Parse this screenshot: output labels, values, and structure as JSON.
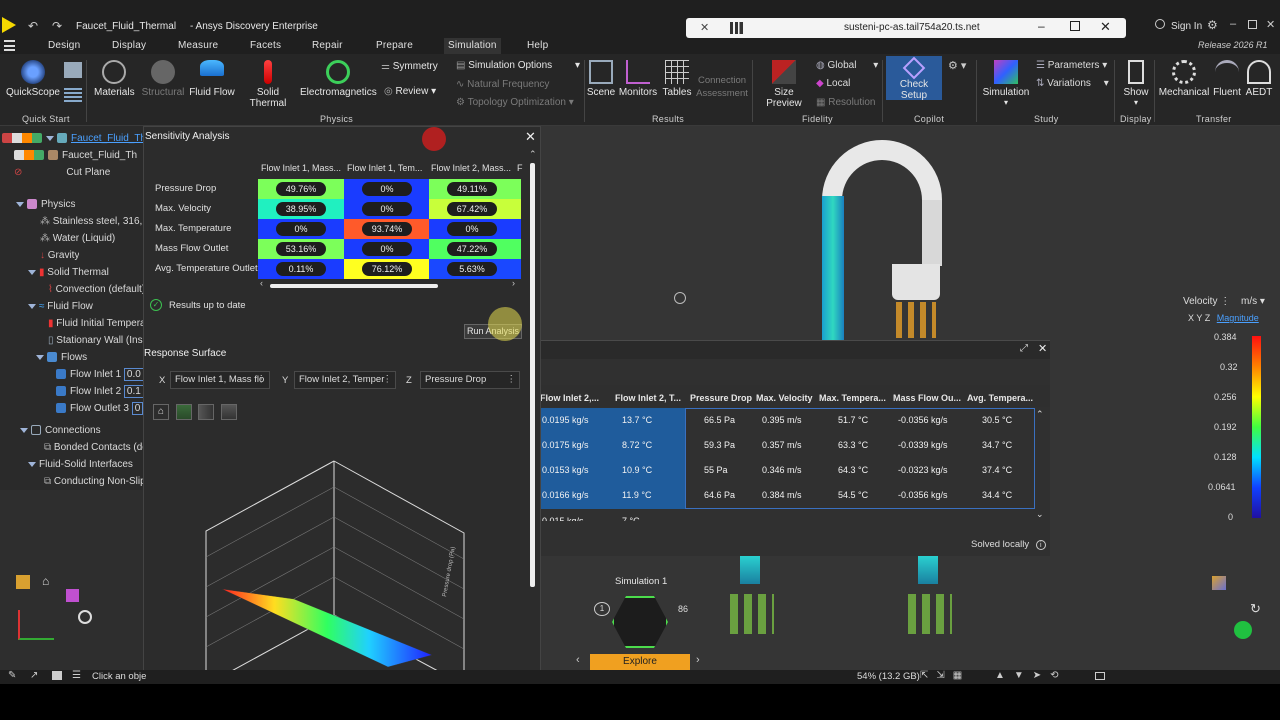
{
  "app": {
    "title": "Faucet_Fluid_Thermal",
    "product": "- Ansys Discovery Enterprise",
    "remote_host": "susteni-pc-as.tail754a20.ts.net",
    "signin": "Sign In",
    "release": "Release 2026 R1"
  },
  "menu": [
    "Design",
    "Display",
    "Measure",
    "Facets",
    "Repair",
    "Prepare",
    "Simulation",
    "Help"
  ],
  "ribbon": {
    "quickscope": "QuickScope",
    "materials": "Materials",
    "structural": "Structural",
    "fluid_flow": "Fluid Flow",
    "solid_thermal": "Solid Thermal",
    "electromagnetics": "Electromagnetics",
    "symmetry": "Symmetry",
    "review": "Review",
    "simulation_options": "Simulation Options",
    "natural_frequency": "Natural Frequency",
    "topology_optimization": "Topology Optimization",
    "scene": "Scene",
    "monitors": "Monitors",
    "tables": "Tables",
    "connection_assessment_1": "Connection",
    "connection_assessment_2": "Assessment",
    "size_preview": "Size Preview",
    "global": "Global",
    "local": "Local",
    "resolution": "Resolution",
    "check_setup": "Check Setup",
    "simulation": "Simulation",
    "parameters": "Parameters",
    "variations": "Variations",
    "show": "Show",
    "mechanical": "Mechanical",
    "fluent": "Fluent",
    "aedt": "AEDT",
    "groups": {
      "quick_start": "Quick Start",
      "physics": "Physics",
      "results": "Results",
      "fidelity": "Fidelity",
      "copilot": "Copilot",
      "study": "Study",
      "display": "Display",
      "transfer": "Transfer"
    }
  },
  "tree": {
    "root": "Faucet_Fluid_The",
    "item1": "Faucet_Fluid_Th",
    "cut_plane": "Cut Plane",
    "physics": "Physics",
    "material1": "Stainless steel, 316, an",
    "material2": "Water (Liquid)",
    "gravity": "Gravity",
    "solid_thermal": "Solid Thermal",
    "convection": "Convection (default)",
    "fluid_flow": "Fluid Flow",
    "fluid_initial": "Fluid Initial Tempera",
    "stationary_wall": "Stationary Wall (Insu",
    "flows": "Flows",
    "flow_inlet1": "Flow Inlet 1",
    "flow_inlet1_val": "0.0",
    "flow_inlet2": "Flow Inlet 2",
    "flow_inlet2_val": "0.1",
    "flow_outlet3": "Flow Outlet 3",
    "flow_outlet3_val": "0",
    "connections": "Connections",
    "bonded": "Bonded Contacts (de",
    "fsi": "Fluid-Solid Interfaces",
    "conducting": "Conducting Non-Slip"
  },
  "sensitivity": {
    "title": "Sensitivity Analysis",
    "columns": [
      "Flow Inlet 1, Mass...",
      "Flow Inlet 1, Tem...",
      "Flow Inlet 2, Mass...",
      "F"
    ],
    "rows": [
      {
        "label": "Pressure Drop",
        "values": [
          "49.76%",
          "0%",
          "49.11%"
        ],
        "colors": [
          "#7cff5a",
          "#1a3cff",
          "#7cff5a"
        ]
      },
      {
        "label": "Max. Velocity",
        "values": [
          "38.95%",
          "0%",
          "67.42%"
        ],
        "colors": [
          "#20f0c0",
          "#1a3cff",
          "#c8ff3a"
        ]
      },
      {
        "label": "Max. Temperature",
        "values": [
          "0%",
          "93.74%",
          "0%"
        ],
        "colors": [
          "#1a3cff",
          "#ff5a2a",
          "#1a3cff"
        ]
      },
      {
        "label": "Mass Flow Outlet",
        "values": [
          "53.16%",
          "0%",
          "47.22%"
        ],
        "colors": [
          "#7cff5a",
          "#1a3cff",
          "#50ff60"
        ]
      },
      {
        "label": "Avg. Temperature Outlet",
        "values": [
          "0.11%",
          "76.12%",
          "5.63%"
        ],
        "colors": [
          "#1a3cff",
          "#ffff20",
          "#1a48ff"
        ]
      }
    ],
    "status": "Results up to date",
    "run_analysis": "Run Analysis",
    "response_surface": "Response Surface",
    "x_label": "X",
    "x_value": "Flow Inlet 1, Mass flo",
    "y_label": "Y",
    "y_value": "Flow Inlet 2, Temper",
    "z_label": "Z",
    "z_value": "Pressure Drop",
    "z_axis_text": "Pressure drop (Pa)"
  },
  "results_table": {
    "headers": [
      "Flow Inlet 2,...",
      "Flow Inlet 2, T...",
      "Pressure Drop",
      "Max. Velocity",
      "Max. Tempera...",
      "Mass Flow Ou...",
      "Avg. Tempera..."
    ],
    "rows": [
      [
        "0.0195 kg/s",
        "13.7 °C",
        "66.5 Pa",
        "0.395 m/s",
        "51.7 °C",
        "-0.0356 kg/s",
        "30.5 °C"
      ],
      [
        "0.0175 kg/s",
        "8.72 °C",
        "59.3 Pa",
        "0.357 m/s",
        "63.3 °C",
        "-0.0339 kg/s",
        "34.7 °C"
      ],
      [
        "0.0153 kg/s",
        "10.9 °C",
        "55 Pa",
        "0.346 m/s",
        "64.3 °C",
        "-0.0323 kg/s",
        "37.4 °C"
      ],
      [
        "0.0166 kg/s",
        "11.9 °C",
        "64.6 Pa",
        "0.384 m/s",
        "54.5 °C",
        "-0.0356 kg/s",
        "34.4 °C"
      ]
    ],
    "partial_row": [
      "0.015 kg/s",
      "7 °C"
    ],
    "solved": "Solved locally"
  },
  "legend": {
    "quantity": "Velocity",
    "unit": "m/s",
    "x": "X",
    "y": "Y",
    "z": "Z",
    "mode": "Magnitude",
    "ticks": [
      "0.384",
      "0.32",
      "0.256",
      "0.192",
      "0.128",
      "0.0641",
      "0"
    ]
  },
  "simulation_widget": {
    "label": "Simulation 1",
    "count_left": "1",
    "count_right": "86",
    "explore": "Explore"
  },
  "status": {
    "hint": "Click an obje",
    "memory": "54% (13.2 GB)"
  },
  "colors": {
    "accent_blue": "#2a5a9a",
    "explore_orange": "#f0a020",
    "selected_row": "#1f5c9c"
  }
}
